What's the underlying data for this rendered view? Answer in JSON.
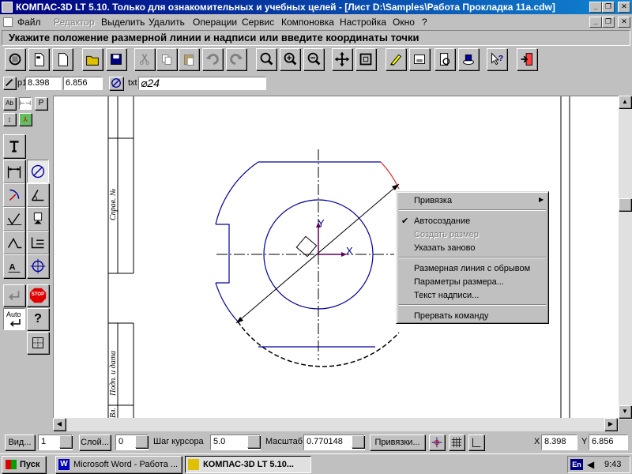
{
  "window": {
    "title": "КОМПАС-3D LT 5.10. Только для ознакомительных и учебных целей - [Лист D:\\Samples\\Работа Прокладка 11а.cdw]",
    "controls": [
      "_",
      "❐",
      "✕"
    ],
    "doc_controls": [
      "_",
      "❐",
      "✕"
    ]
  },
  "menu": {
    "items": [
      {
        "label": "Файл",
        "enabled": true
      },
      {
        "label": "Редактор",
        "enabled": false
      },
      {
        "label": "Выделить",
        "enabled": true
      },
      {
        "label": "Удалить",
        "enabled": true
      },
      {
        "label": "Операции",
        "enabled": true
      },
      {
        "label": "Сервис",
        "enabled": true
      },
      {
        "label": "Компоновка",
        "enabled": true
      },
      {
        "label": "Настройка",
        "enabled": true
      },
      {
        "label": "Окно",
        "enabled": true
      },
      {
        "label": "?",
        "enabled": true
      }
    ]
  },
  "prompt": {
    "text": "Укажите положение размерной линии и надписи или введите координаты точки"
  },
  "toolbar": {
    "buttons": [
      "print-icon",
      "new-doc-icon",
      "new-sheet-icon",
      "open-icon",
      "save-icon",
      "cut-icon",
      "copy-icon",
      "paste-icon",
      "undo-icon",
      "redo-icon",
      "zoom-icon",
      "zoom-in-icon",
      "zoom-out-icon",
      "pan-icon",
      "fit-icon",
      "pencil-icon",
      "sheet-icon",
      "preview-icon",
      "layers-icon",
      "help-pointer-icon",
      "exit-icon"
    ]
  },
  "params": {
    "p1_label": "p1",
    "x": "8.398",
    "y": "6.856",
    "txt_label": "txt",
    "txt_value": "⌀24"
  },
  "palette": {
    "tabs": [
      "Ab",
      "⊢⊣",
      "P",
      "↕",
      "⅄"
    ],
    "auto_label": "Auto",
    "stop_label": "STOP",
    "help_label": "?"
  },
  "drawing": {
    "title_block_1": "Справ. №",
    "title_block_2": "Подп. и дата",
    "title_block_3": "Вл.",
    "axis_x": "X",
    "axis_y": "Y"
  },
  "context_menu": {
    "items": [
      {
        "label": "Привязка",
        "submenu": true,
        "checked": false,
        "enabled": true
      },
      {
        "label": "Автосоздание",
        "submenu": false,
        "checked": true,
        "enabled": true
      },
      {
        "label": "Создать размер",
        "submenu": false,
        "checked": false,
        "enabled": false
      },
      {
        "label": "Указать заново",
        "submenu": false,
        "checked": false,
        "enabled": true
      },
      {
        "label": "Размерная линия с обрывом",
        "submenu": false,
        "checked": false,
        "enabled": true
      },
      {
        "label": "Параметры размера...",
        "submenu": false,
        "checked": false,
        "enabled": true
      },
      {
        "label": "Текст надписи...",
        "submenu": false,
        "checked": false,
        "enabled": true
      },
      {
        "label": "Прервать команду",
        "submenu": false,
        "checked": false,
        "enabled": true
      }
    ]
  },
  "status": {
    "view_label": "Вид...",
    "view_value": "1",
    "layer_label": "Слой...",
    "layer_value": "0",
    "step_label": "Шаг курсора",
    "step_value": "5.0",
    "scale_label": "Масштаб",
    "scale_value": "0.770148",
    "snap_label": "Привязки...",
    "x_label": "X",
    "x_value": "8.398",
    "y_label": "Y",
    "y_value": "6.856"
  },
  "taskbar": {
    "start": "Пуск",
    "tasks": [
      "Microsoft Word - Работа ...",
      "КОМПАС-3D LT 5.10..."
    ],
    "lang": "En",
    "time": "9:43"
  },
  "colors": {
    "title_start": "#000080",
    "title_end": "#1084d0",
    "drawing_blue": "#0000a0",
    "selection_red": "#e02020",
    "axis_purple": "#600060"
  }
}
